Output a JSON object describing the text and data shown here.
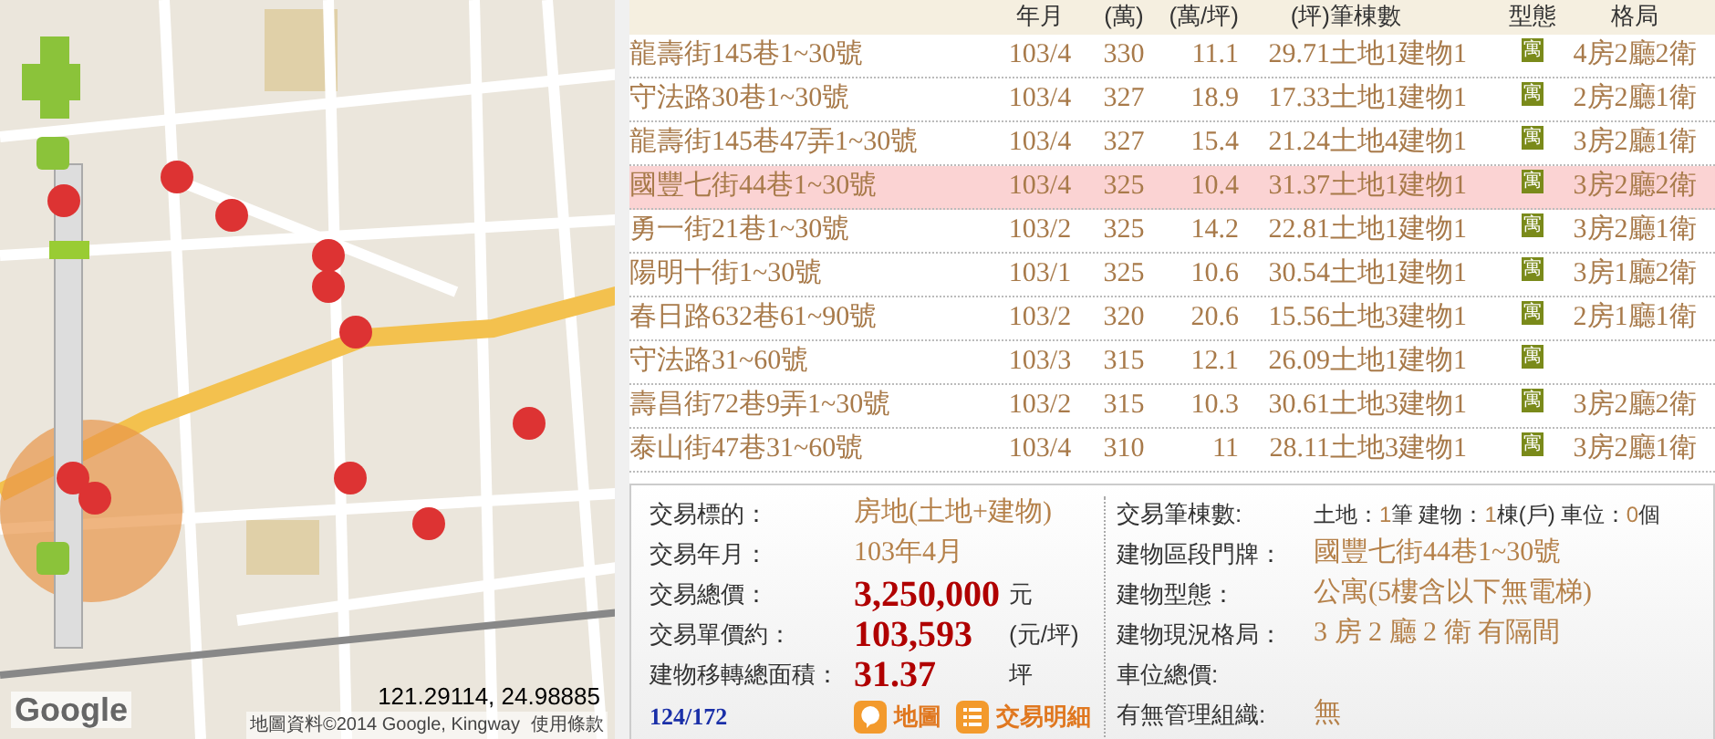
{
  "map": {
    "coordinates": "121.29114, 24.98885",
    "attribution": "地圖資料©2014 Google, Kingway",
    "terms_link": "使用條款",
    "logo": "Google"
  },
  "table": {
    "columns": [
      "",
      "年月",
      "(萬)",
      "(萬/坪)",
      "(坪)",
      "筆棟數",
      "型態",
      "格局"
    ],
    "rows": [
      {
        "address": "龍壽街145巷1~30號",
        "date": "103/4",
        "total": "330",
        "unit_price": "11.1",
        "area": "29.71",
        "counts": "土地1建物1",
        "type": "寓",
        "layout": "4房2廳2衛",
        "selected": false
      },
      {
        "address": "守法路30巷1~30號",
        "date": "103/4",
        "total": "327",
        "unit_price": "18.9",
        "area": "17.33",
        "counts": "土地1建物1",
        "type": "寓",
        "layout": "2房2廳1衛",
        "selected": false
      },
      {
        "address": "龍壽街145巷47弄1~30號",
        "date": "103/4",
        "total": "327",
        "unit_price": "15.4",
        "area": "21.24",
        "counts": "土地4建物1",
        "type": "寓",
        "layout": "3房2廳1衛",
        "selected": false
      },
      {
        "address": "國豐七街44巷1~30號",
        "date": "103/4",
        "total": "325",
        "unit_price": "10.4",
        "area": "31.37",
        "counts": "土地1建物1",
        "type": "寓",
        "layout": "3房2廳2衛",
        "selected": true
      },
      {
        "address": "勇一街21巷1~30號",
        "date": "103/2",
        "total": "325",
        "unit_price": "14.2",
        "area": "22.81",
        "counts": "土地1建物1",
        "type": "寓",
        "layout": "3房2廳1衛",
        "selected": false
      },
      {
        "address": "陽明十街1~30號",
        "date": "103/1",
        "total": "325",
        "unit_price": "10.6",
        "area": "30.54",
        "counts": "土地1建物1",
        "type": "寓",
        "layout": "3房1廳2衛",
        "selected": false
      },
      {
        "address": "春日路632巷61~90號",
        "date": "103/2",
        "total": "320",
        "unit_price": "20.6",
        "area": "15.56",
        "counts": "土地3建物1",
        "type": "寓",
        "layout": "2房1廳1衛",
        "selected": false
      },
      {
        "address": "守法路31~60號",
        "date": "103/3",
        "total": "315",
        "unit_price": "12.1",
        "area": "26.09",
        "counts": "土地1建物1",
        "type": "寓",
        "layout": "",
        "selected": false
      },
      {
        "address": "壽昌街72巷9弄1~30號",
        "date": "103/2",
        "total": "315",
        "unit_price": "10.3",
        "area": "30.61",
        "counts": "土地3建物1",
        "type": "寓",
        "layout": "3房2廳2衛",
        "selected": false
      },
      {
        "address": "泰山街47巷31~60號",
        "date": "103/4",
        "total": "310",
        "unit_price": "11",
        "area": "28.11",
        "counts": "土地3建物1",
        "type": "寓",
        "layout": "3房2廳1衛",
        "selected": false
      }
    ]
  },
  "detail": {
    "left": [
      {
        "kind": "plain",
        "label": "交易標的：",
        "value": "房地(土地+建物)"
      },
      {
        "kind": "plain",
        "label": "交易年月：",
        "value": "103年4月"
      },
      {
        "kind": "big",
        "label": "交易總價：",
        "value": "3,250,000",
        "unit": "元"
      },
      {
        "kind": "big",
        "label": "交易單價約：",
        "value": "103,593",
        "unit": "(元/坪)"
      },
      {
        "kind": "big",
        "label": "建物移轉總面積：",
        "value": "31.37",
        "unit": "坪"
      }
    ],
    "pager": "124/172",
    "buttons": [
      {
        "kind": "map",
        "label": "地圖"
      },
      {
        "kind": "list",
        "label": "交易明細"
      }
    ],
    "right": [
      {
        "kind": "counts",
        "label": "交易筆棟數:",
        "parts": [
          {
            "label": "土地：",
            "value": "1",
            "unit": "筆"
          },
          {
            "label": "建物：",
            "value": "1",
            "unit": "棟(戶)"
          },
          {
            "label": "車位：",
            "value": "0",
            "unit": "個"
          }
        ]
      },
      {
        "kind": "plain",
        "label": "建物區段門牌：",
        "value": "國豐七街44巷1~30號"
      },
      {
        "kind": "plain",
        "label": "建物型態：",
        "value": "公寓(5樓含以下無電梯)"
      },
      {
        "kind": "plain",
        "label": "建物現況格局：",
        "value": "3 房 2 廳 2 衛 有隔間"
      },
      {
        "kind": "plain",
        "label": "車位總價:"
      },
      {
        "kind": "plain",
        "label": "有無管理組織:",
        "value": "無"
      }
    ]
  }
}
